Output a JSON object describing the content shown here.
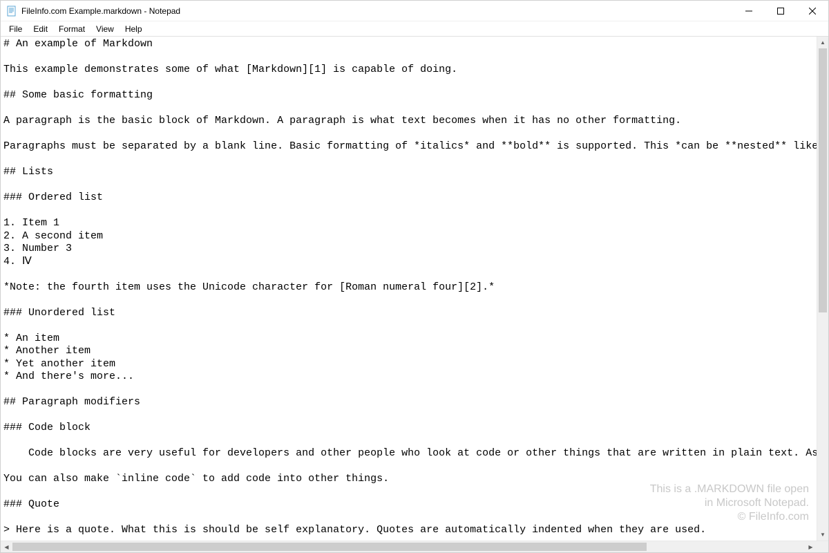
{
  "window": {
    "title": "FileInfo.com Example.markdown - Notepad"
  },
  "menus": {
    "file": "File",
    "edit": "Edit",
    "format": "Format",
    "view": "View",
    "help": "Help"
  },
  "editor": {
    "content": "# An example of Markdown\n\nThis example demonstrates some of what [Markdown][1] is capable of doing.\n\n## Some basic formatting\n\nA paragraph is the basic block of Markdown. A paragraph is what text becomes when it has no other formatting.\n\nParagraphs must be separated by a blank line. Basic formatting of *italics* and **bold** is supported. This *can be **nested** like* so.\n\n## Lists\n\n### Ordered list\n\n1. Item 1\n2. A second item\n3. Number 3\n4. Ⅳ\n\n*Note: the fourth item uses the Unicode character for [Roman numeral four][2].*\n\n### Unordered list\n\n* An item\n* Another item\n* Yet another item\n* And there's more...\n\n## Paragraph modifiers\n\n### Code block\n\n    Code blocks are very useful for developers and other people who look at code or other things that are written in plain text. As you can see,\n\nYou can also make `inline code` to add code into other things.\n\n### Quote\n\n> Here is a quote. What this is should be self explanatory. Quotes are automatically indented when they are used."
  },
  "watermark": {
    "line1": "This is a .MARKDOWN file open",
    "line2": "in Microsoft Notepad.",
    "line3": "© FileInfo.com"
  }
}
